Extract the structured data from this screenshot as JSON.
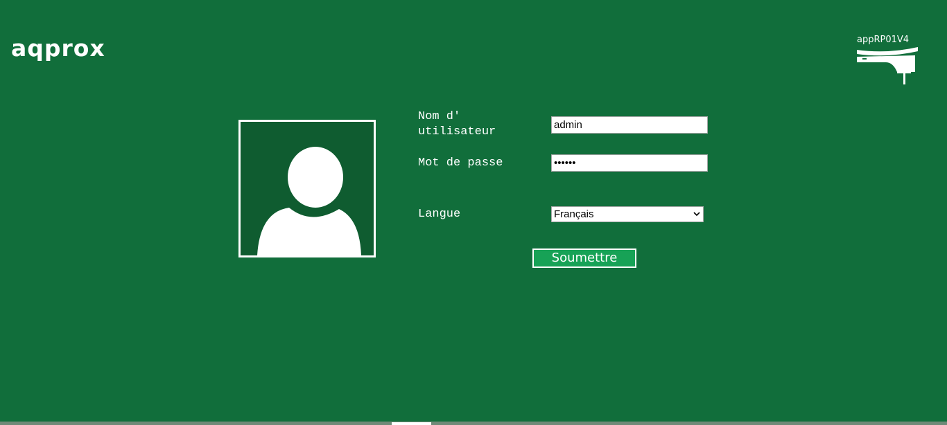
{
  "brand": {
    "logo_text": "aqprox"
  },
  "device": {
    "model": "appRP01V4",
    "icon": "powerline-adapter-icon"
  },
  "avatar": {
    "icon": "user-silhouette-icon"
  },
  "form": {
    "username_label": "Nom d' utilisateur",
    "username_value": "admin",
    "password_label": "Mot de passe",
    "password_value": "••••••",
    "language_label": "Langue",
    "language_value": "Français",
    "submit_label": "Soumettre"
  },
  "colors": {
    "background": "#116e3b",
    "avatar_background": "#0f5c30",
    "button_background": "#17a256",
    "text": "#ffffff"
  }
}
